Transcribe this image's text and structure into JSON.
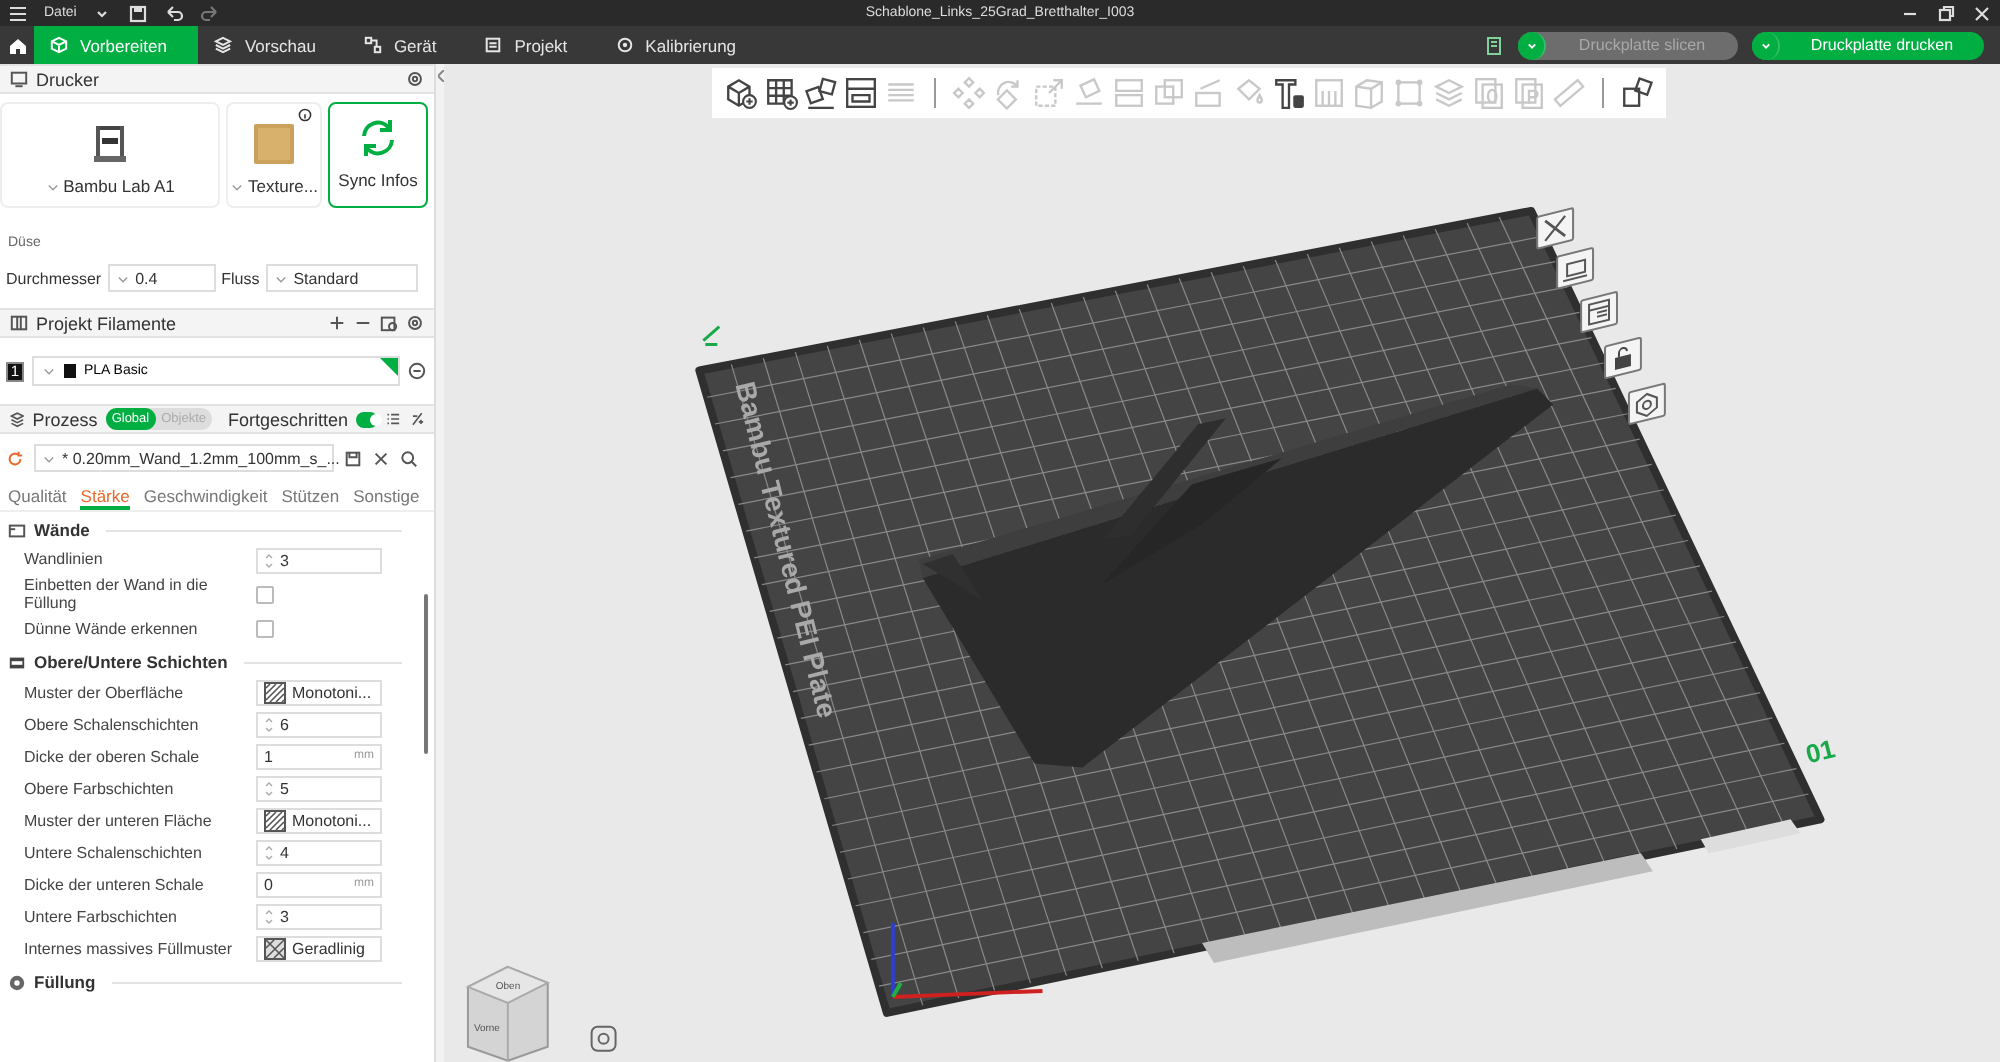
{
  "menu": {
    "label": "Datei"
  },
  "window": {
    "title": "Schablone_Links_25Grad_Bretthalter_I003"
  },
  "tabs": [
    {
      "label": "Vorbereiten",
      "selected": true
    },
    {
      "label": "Vorschau",
      "selected": false
    },
    {
      "label": "Gerät",
      "selected": false
    },
    {
      "label": "Projekt",
      "selected": false
    },
    {
      "label": "Kalibrierung",
      "selected": false
    }
  ],
  "actions": [
    {
      "label": "Druckplatte slicen",
      "disabled": true
    },
    {
      "label": "Druckplatte drucken",
      "disabled": false
    }
  ],
  "printer": {
    "title": "Drucker",
    "cards": [
      {
        "label": "Bambu Lab A1",
        "kind": "printer",
        "selected": false
      },
      {
        "label": "Texture...",
        "kind": "plate",
        "selected": false
      },
      {
        "label": "Sync Infos",
        "kind": "sync",
        "selected": true
      }
    ],
    "nozzle_label": "Düse",
    "diameter_label": "Durchmesser",
    "diameter": "0.4",
    "flow_label": "Fluss",
    "flow": "Standard"
  },
  "filaments": {
    "title": "Projekt Filamente",
    "items": [
      {
        "index": "1",
        "name": "PLA Basic",
        "color": "#111111"
      }
    ]
  },
  "process": {
    "title": "Prozess",
    "scope": [
      {
        "label": "Global",
        "selected": true
      },
      {
        "label": "Objekte",
        "selected": false
      }
    ],
    "advanced_label": "Fortgeschritten",
    "advanced": true,
    "preset": "* 0.20mm_Wand_1.2mm_100mm_s_...",
    "tabs": [
      {
        "label": "Qualität",
        "selected": false
      },
      {
        "label": "Stärke",
        "selected": true
      },
      {
        "label": "Geschwindigkeit",
        "selected": false
      },
      {
        "label": "Stützen",
        "selected": false
      },
      {
        "label": "Sonstige",
        "selected": false
      }
    ],
    "sections": [
      {
        "title": "Wände",
        "kind": "walls",
        "rows": [
          {
            "label": "Wandlinien",
            "kind": "spin",
            "value": "3"
          },
          {
            "label": "Einbetten der Wand in die Füllung",
            "kind": "checkbox",
            "checked": false
          },
          {
            "label": "Dünne Wände erkennen",
            "kind": "checkbox",
            "checked": false
          }
        ]
      },
      {
        "title": "Obere/Untere Schichten",
        "kind": "layers",
        "rows": [
          {
            "label": "Muster der Oberfläche",
            "kind": "pattern",
            "value": "Monotoni..."
          },
          {
            "label": "Obere Schalenschichten",
            "kind": "spin",
            "value": "6"
          },
          {
            "label": "Dicke der oberen Schale",
            "kind": "number",
            "value": "1",
            "unit": "mm"
          },
          {
            "label": "Obere Farbschichten",
            "kind": "spin",
            "value": "5"
          },
          {
            "label": "Muster der unteren Fläche",
            "kind": "pattern",
            "value": "Monotoni..."
          },
          {
            "label": "Untere Schalenschichten",
            "kind": "spin",
            "value": "4"
          },
          {
            "label": "Dicke der unteren Schale",
            "kind": "number",
            "value": "0",
            "unit": "mm"
          },
          {
            "label": "Untere Farbschichten",
            "kind": "spin",
            "value": "3"
          },
          {
            "label": "Internes massives Füllmuster",
            "kind": "pattern2",
            "value": "Geradlinig"
          }
        ]
      },
      {
        "title": "Füllung",
        "kind": "infill"
      }
    ]
  },
  "toolbar": [
    [
      {
        "kind": "add-cube",
        "disabled": false
      },
      {
        "kind": "add-plate",
        "disabled": false
      },
      {
        "kind": "arrange",
        "disabled": false
      },
      {
        "kind": "layout",
        "disabled": false
      },
      {
        "kind": "lines",
        "disabled": true
      }
    ],
    [
      {
        "kind": "move",
        "disabled": true
      },
      {
        "kind": "rotate",
        "disabled": true
      },
      {
        "kind": "scale",
        "disabled": true
      },
      {
        "kind": "place",
        "disabled": true
      },
      {
        "kind": "split",
        "disabled": true
      },
      {
        "kind": "boolean",
        "disabled": true
      },
      {
        "kind": "cut",
        "disabled": true
      },
      {
        "kind": "paint",
        "disabled": true
      },
      {
        "kind": "text",
        "disabled": false
      },
      {
        "kind": "support",
        "disabled": true
      },
      {
        "kind": "cube",
        "disabled": true
      },
      {
        "kind": "bbox",
        "disabled": true
      },
      {
        "kind": "layers",
        "disabled": true
      },
      {
        "kind": "copy",
        "disabled": true
      },
      {
        "kind": "paste",
        "disabled": true
      },
      {
        "kind": "ruler",
        "disabled": true
      }
    ],
    [
      {
        "kind": "assembly",
        "disabled": false
      }
    ]
  ],
  "viewport": {
    "plate_label": "Bambu Textured PEI Plate",
    "plate_number": "01",
    "cube_top": "Oben",
    "cube_front": "Vorne"
  }
}
